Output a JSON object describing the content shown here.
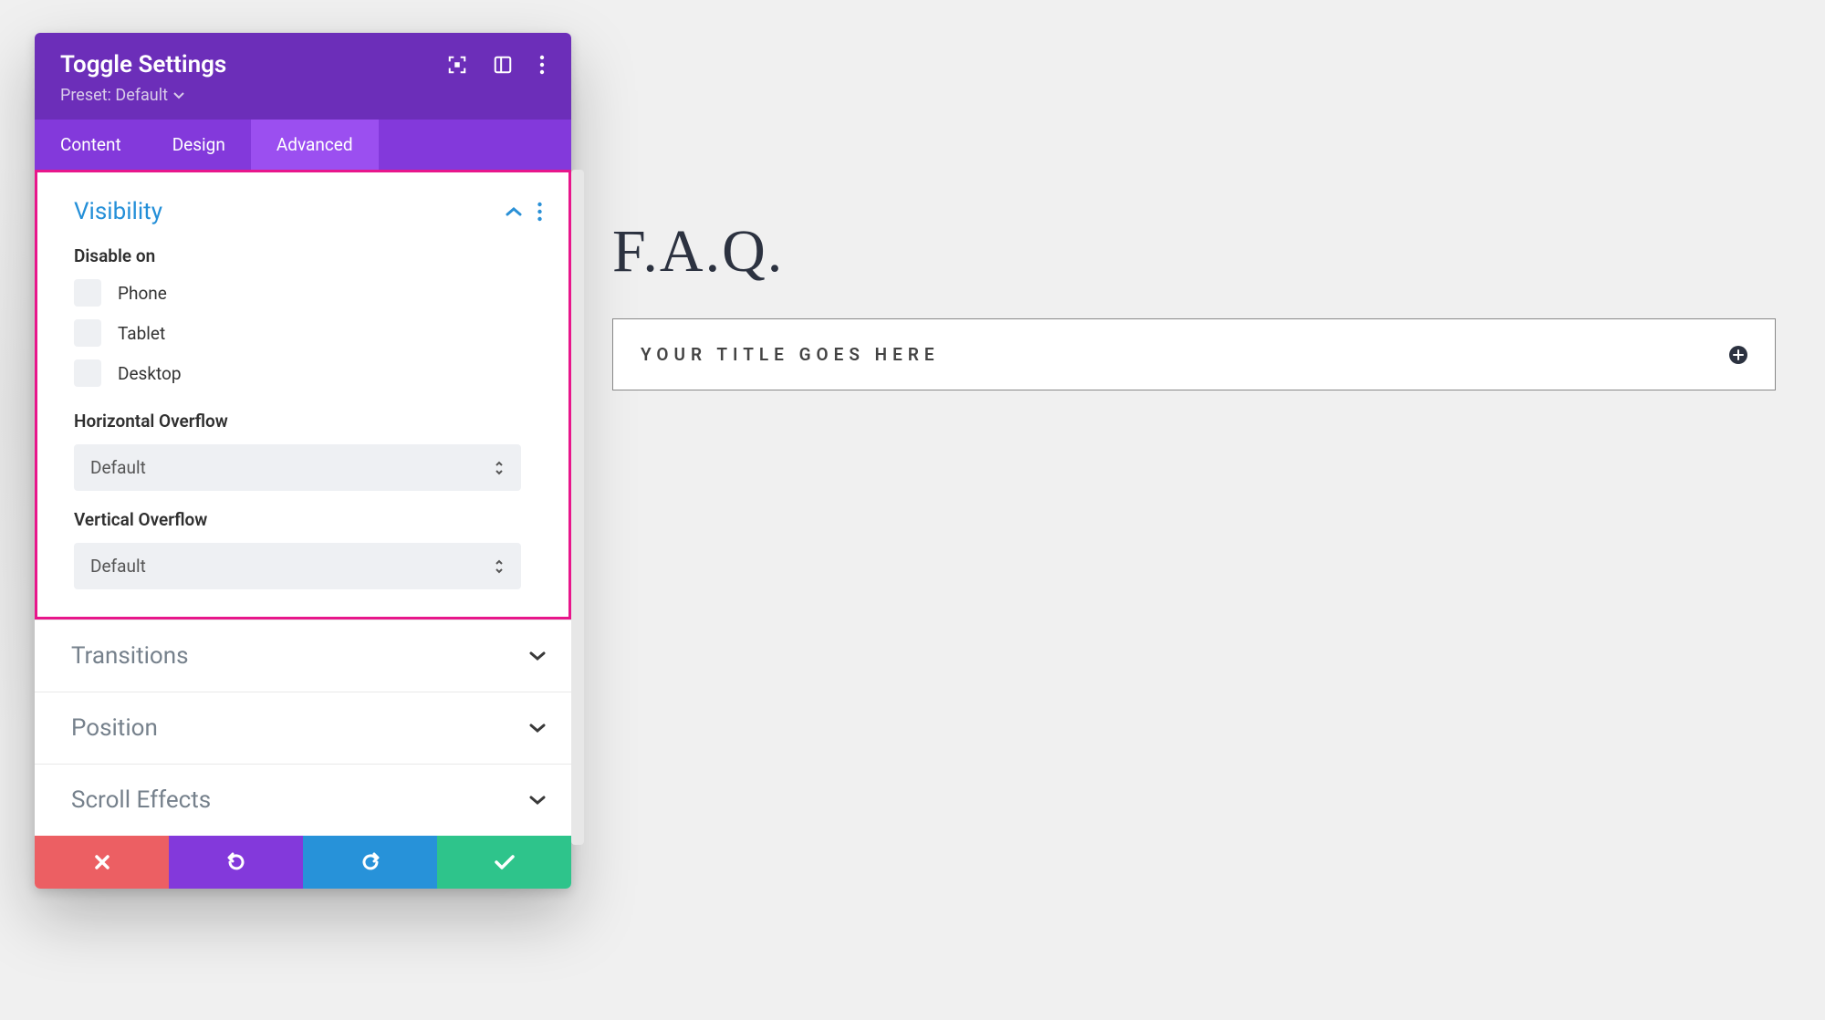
{
  "panel": {
    "title": "Toggle Settings",
    "preset_label": "Preset: Default",
    "tabs": {
      "content": "Content",
      "design": "Design",
      "advanced": "Advanced"
    }
  },
  "visibility": {
    "title": "Visibility",
    "disable_label": "Disable on",
    "options": {
      "phone": "Phone",
      "tablet": "Tablet",
      "desktop": "Desktop"
    },
    "h_overflow_label": "Horizontal Overflow",
    "h_overflow_value": "Default",
    "v_overflow_label": "Vertical Overflow",
    "v_overflow_value": "Default"
  },
  "sections": {
    "transitions": "Transitions",
    "position": "Position",
    "scroll_effects": "Scroll Effects"
  },
  "preview": {
    "heading": "F.A.Q.",
    "toggle_title": "YOUR TITLE GOES HERE"
  },
  "colors": {
    "header": "#6c2eb9",
    "tabbar": "#8339db",
    "tab_active": "#9b4ff0",
    "highlight": "#e8168b",
    "link_blue": "#248fd8",
    "cancel": "#ec5f63",
    "redo": "#2792d9",
    "save": "#2ec48b"
  }
}
